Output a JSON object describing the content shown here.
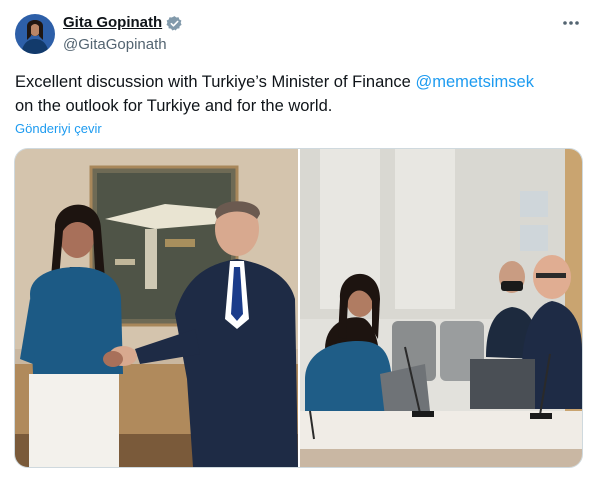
{
  "author": {
    "name": "Gita Gopinath",
    "handle": "@GitaGopinath"
  },
  "tweet": {
    "text_before": "Excellent discussion with Turkiye’s Minister of Finance ",
    "mention": "@memetsimsek",
    "text_after": "on the outlook for Turkiye and for the world.",
    "translate_label": "Gönderiyi çevir"
  },
  "icons": {
    "verified": "verified-badge-icon",
    "more": "more-options-icon"
  },
  "colors": {
    "link": "#1d9bf0",
    "handle": "#536471",
    "text": "#0f1419"
  }
}
